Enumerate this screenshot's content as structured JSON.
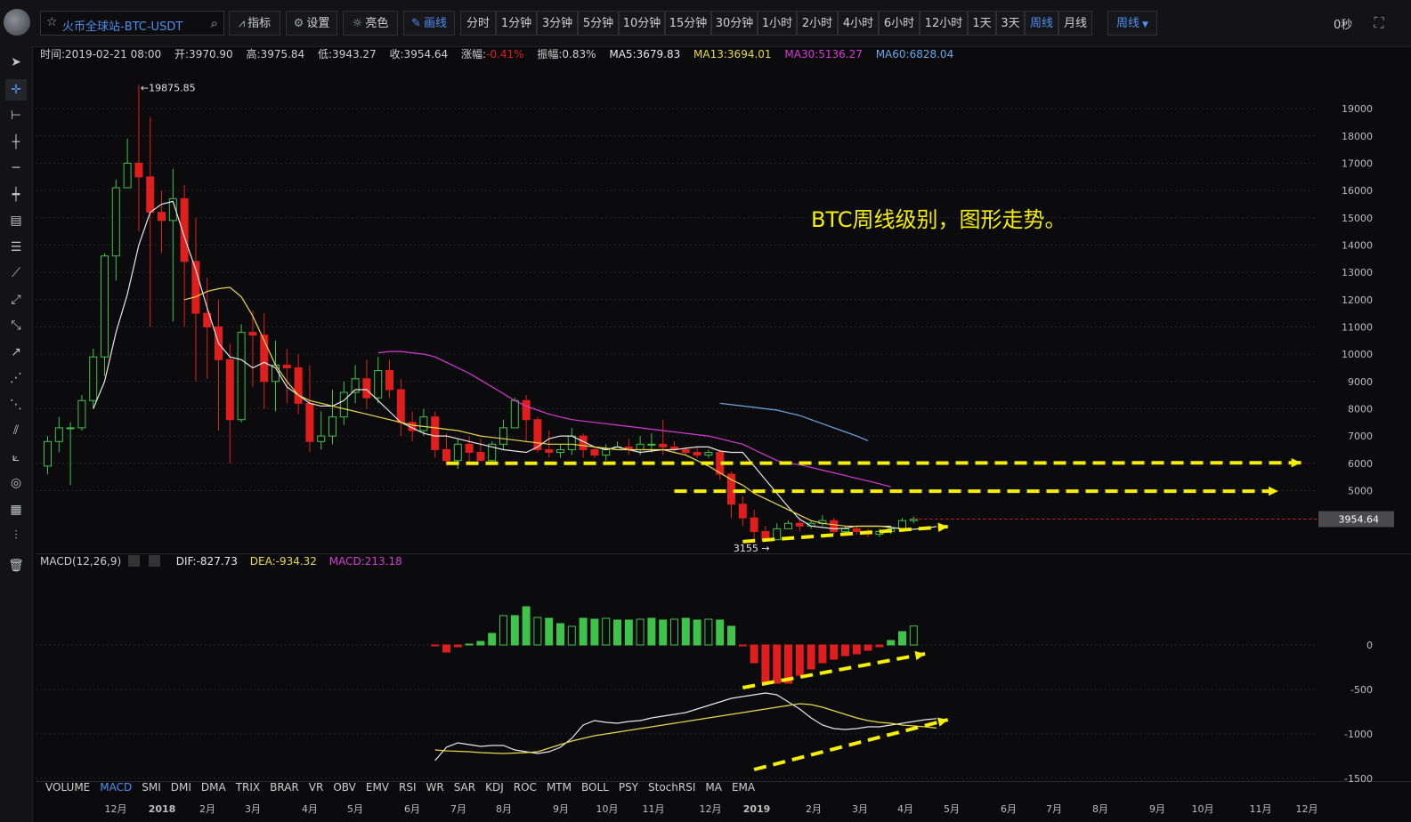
{
  "toolbar": {
    "symbol": "火币全球站-BTC-USDT",
    "indicator_btn": "指标",
    "settings_btn": "设置",
    "theme_btn": "亮色",
    "draw_btn": "画线",
    "periods": [
      "分时",
      "1分钟",
      "3分钟",
      "5分钟",
      "10分钟",
      "15分钟",
      "30分钟",
      "1小时",
      "2小时",
      "4小时",
      "6小时",
      "12小时",
      "1天",
      "3天",
      "周线",
      "月线"
    ],
    "active_period": "周线",
    "period_dropdown": "周线",
    "timer": "0秒"
  },
  "info": {
    "time": "时间:2019-02-21 08:00",
    "open": "开:3970.90",
    "high": "高:3975.84",
    "low": "低:3943.27",
    "close": "收:3954.64",
    "change_label": "涨幅:",
    "change_value": "-0.41%",
    "amplitude": "振幅:0.83%",
    "ma5": "MA5:3679.83",
    "ma13": "MA13:3694.01",
    "ma30": "MA30:5136.27",
    "ma60": "MA60:6828.04"
  },
  "macd_info": {
    "title": "MACD(12,26,9)",
    "dif": "DIF:-827.73",
    "dea": "DEA:-934.32",
    "macd": "MACD:213.18"
  },
  "annotation": "BTC周线级别，图形走势。",
  "indicators": [
    "VOLUME",
    "MACD",
    "SMI",
    "DMI",
    "DMA",
    "TRIX",
    "BRAR",
    "VR",
    "OBV",
    "EMV",
    "RSI",
    "WR",
    "SAR",
    "KDJ",
    "ROC",
    "MTM",
    "BOLL",
    "PSY",
    "StochRSI",
    "MA",
    "EMA"
  ],
  "active_indicator": "MACD",
  "colors": {
    "up": "#3fc34a",
    "down": "#e01e1e",
    "ma5": "#e8e8e8",
    "ma13": "#e8d84a",
    "ma30": "#d43bd4",
    "ma60": "#6aa8e8",
    "accent": "#4d8ff0",
    "annotation": "#f6f000"
  },
  "chart_data": {
    "type": "candlestick",
    "price_axis": {
      "ylim": [
        2700,
        20700
      ],
      "ticks": [
        5000,
        6000,
        7000,
        8000,
        9000,
        10000,
        11000,
        12000,
        13000,
        14000,
        15000,
        16000,
        17000,
        18000,
        19000
      ]
    },
    "macd_axis": {
      "ylim": [
        -1530,
        830
      ],
      "ticks": [
        0,
        -500,
        -1000,
        -1500
      ]
    },
    "x_labels": [
      "12月",
      "2018",
      "2月",
      "3月",
      "4月",
      "5月",
      "6月",
      "7月",
      "8月",
      "9月",
      "10月",
      "11月",
      "12月",
      "2019",
      "2月",
      "3月",
      "4月",
      "5月",
      "6月",
      "7月",
      "8月",
      "9月",
      "10月",
      "11月",
      "12月"
    ],
    "last_price": "3954.64",
    "high_label": "19875.85",
    "low_label": "3155",
    "candles": [
      [
        5900,
        6800,
        5600,
        7000
      ],
      [
        6800,
        7300,
        6400,
        7700
      ],
      [
        7300,
        7300,
        5200,
        7500
      ],
      [
        7300,
        8300,
        7200,
        8500
      ],
      [
        8300,
        9900,
        8000,
        10200
      ],
      [
        9900,
        13600,
        9200,
        13700
      ],
      [
        13600,
        16100,
        12700,
        16400
      ],
      [
        16100,
        17000,
        16200,
        17900
      ],
      [
        17000,
        16500,
        14500,
        19876
      ],
      [
        16500,
        15200,
        11000,
        18700
      ],
      [
        15200,
        14900,
        13700,
        16000
      ],
      [
        14900,
        15700,
        11200,
        16800
      ],
      [
        15700,
        13400,
        11000,
        16200
      ],
      [
        13400,
        11500,
        9000,
        15000
      ],
      [
        11500,
        11000,
        9100,
        12800
      ],
      [
        11000,
        9800,
        7200,
        12000
      ],
      [
        9800,
        7600,
        6000,
        10400
      ],
      [
        7600,
        10800,
        7500,
        11100
      ],
      [
        10800,
        10700,
        8800,
        11600
      ],
      [
        10700,
        9000,
        8000,
        11500
      ],
      [
        9000,
        9600,
        7900,
        10500
      ],
      [
        9600,
        9500,
        8200,
        10200
      ],
      [
        9500,
        8200,
        7800,
        10000
      ],
      [
        8200,
        6800,
        6400,
        9600
      ],
      [
        6800,
        7000,
        6500,
        7900
      ],
      [
        7000,
        7700,
        6700,
        8700
      ],
      [
        7700,
        8600,
        7400,
        9000
      ],
      [
        8600,
        9100,
        8200,
        9600
      ],
      [
        9100,
        8400,
        8000,
        9800
      ],
      [
        8400,
        9400,
        8200,
        9900
      ],
      [
        9400,
        8700,
        8400,
        9800
      ],
      [
        8700,
        7500,
        7000,
        9100
      ],
      [
        7500,
        7200,
        6800,
        7900
      ],
      [
        7200,
        7700,
        7000,
        8000
      ],
      [
        7700,
        6500,
        6200,
        7900
      ],
      [
        6500,
        6100,
        5900,
        7100
      ],
      [
        6100,
        6700,
        5800,
        6900
      ],
      [
        6700,
        6400,
        6000,
        7000
      ],
      [
        6400,
        6100,
        6100,
        6900
      ],
      [
        6100,
        6700,
        6000,
        6800
      ],
      [
        6700,
        7300,
        6500,
        7600
      ],
      [
        7300,
        8300,
        7300,
        8400
      ],
      [
        8300,
        7600,
        6800,
        8500
      ],
      [
        7600,
        6500,
        6400,
        7700
      ],
      [
        6500,
        6400,
        6200,
        7200
      ],
      [
        6400,
        6500,
        6200,
        6700
      ],
      [
        6500,
        7000,
        6300,
        7300
      ],
      [
        7000,
        6500,
        6200,
        7100
      ],
      [
        6500,
        6300,
        6200,
        6600
      ],
      [
        6300,
        6500,
        6100,
        6700
      ],
      [
        6500,
        6600,
        6500,
        6800
      ],
      [
        6600,
        6500,
        6300,
        6900
      ],
      [
        6500,
        6700,
        6300,
        7000
      ],
      [
        6700,
        6700,
        6400,
        7100
      ],
      [
        6700,
        6600,
        6300,
        7600
      ],
      [
        6600,
        6500,
        6400,
        6800
      ],
      [
        6500,
        6400,
        6300,
        6600
      ],
      [
        6400,
        6300,
        6200,
        6600
      ],
      [
        6300,
        6400,
        6200,
        6500
      ],
      [
        6400,
        5600,
        5400,
        6500
      ],
      [
        5600,
        4500,
        4000,
        5700
      ],
      [
        4500,
        4000,
        3700,
        4800
      ],
      [
        4000,
        3500,
        3200,
        4300
      ],
      [
        3500,
        3200,
        3155,
        3700
      ],
      [
        3200,
        3600,
        3200,
        3800
      ],
      [
        3600,
        3800,
        3600,
        3900
      ],
      [
        3800,
        3700,
        3500,
        4000
      ],
      [
        3700,
        3800,
        3600,
        3900
      ],
      [
        3800,
        3900,
        3700,
        4100
      ],
      [
        3900,
        3500,
        3400,
        4000
      ],
      [
        3500,
        3600,
        3400,
        3700
      ],
      [
        3600,
        3500,
        3400,
        3700
      ],
      [
        3500,
        3400,
        3300,
        3600
      ],
      [
        3400,
        3500,
        3300,
        3600
      ],
      [
        3500,
        3600,
        3400,
        3700
      ],
      [
        3600,
        3900,
        3600,
        4000
      ],
      [
        3900,
        3950,
        3800,
        4050
      ]
    ],
    "series": [
      {
        "id": "ma5",
        "name": "MA5",
        "start": 4,
        "values": [
          8000,
          9000,
          10800,
          12200,
          14000,
          15200,
          15500,
          15600,
          14300,
          13100,
          11700,
          10400,
          9900,
          9800,
          9500,
          9700,
          9500,
          8800,
          8500,
          8200,
          8100,
          8100,
          8300,
          8700,
          8700,
          8300,
          7900,
          7500,
          7300,
          7100,
          7000,
          7000,
          6900,
          6800,
          6700,
          6600,
          6500,
          6450,
          6400,
          6600,
          6900,
          7000,
          7000,
          6800,
          6600,
          6500,
          6600,
          6500,
          6400,
          6450,
          6500,
          6500,
          6550,
          6600,
          6600,
          6450,
          6400,
          6400,
          5900,
          5400,
          4900,
          4400,
          3950,
          3700,
          3650,
          3600,
          3620,
          3700,
          3700,
          3700,
          3650,
          3600,
          3580,
          3620,
          3680
        ]
      },
      {
        "id": "ma13",
        "name": "MA13",
        "start": 12,
        "values": [
          12000,
          12100,
          12300,
          12400,
          12450,
          12100,
          11400,
          10500,
          9600,
          9000,
          8500,
          8300,
          8200,
          8100,
          8000,
          7900,
          7800,
          7700,
          7600,
          7500,
          7400,
          7350,
          7300,
          7250,
          7200,
          7100,
          7000,
          6950,
          6900,
          6850,
          6800,
          6750,
          6700,
          6700,
          6700,
          6650,
          6600,
          6550,
          6500,
          6500,
          6500,
          6500,
          6500,
          6400,
          6300,
          6100,
          5900,
          5650,
          5400,
          5200,
          4900,
          4700,
          4500,
          4300,
          4100,
          3900,
          3800,
          3750,
          3700,
          3690,
          3690,
          3690,
          3694
        ]
      },
      {
        "id": "ma30",
        "name": "MA30",
        "start": 29,
        "values": [
          10050,
          10100,
          10100,
          10050,
          10000,
          9900,
          9700,
          9500,
          9300,
          9050,
          8800,
          8550,
          8300,
          8100,
          7950,
          7800,
          7700,
          7600,
          7550,
          7500,
          7450,
          7400,
          7350,
          7300,
          7250,
          7200,
          7150,
          7100,
          7050,
          7000,
          6900,
          6800,
          6700,
          6500,
          6300,
          6100,
          6000,
          5950,
          5850,
          5750,
          5650,
          5550,
          5450,
          5350,
          5250,
          5136
        ]
      },
      {
        "id": "ma60",
        "name": "MA60",
        "start": 59,
        "values": [
          8200,
          8150,
          8100,
          8050,
          8000,
          7950,
          7850,
          7750,
          7600,
          7450,
          7300,
          7150,
          7000,
          6828
        ]
      }
    ],
    "macd": {
      "start": 34,
      "hist": [
        -10,
        -80,
        -20,
        10,
        40,
        130,
        330,
        330,
        430,
        310,
        300,
        240,
        210,
        300,
        290,
        300,
        280,
        280,
        290,
        300,
        280,
        290,
        300,
        280,
        290,
        280,
        210,
        -10,
        -200,
        -420,
        -430,
        -430,
        -340,
        -270,
        -200,
        -160,
        -120,
        -100,
        -60,
        -20,
        50,
        150,
        213
      ],
      "dif": [
        -1300,
        -1150,
        -1100,
        -1120,
        -1140,
        -1130,
        -1130,
        -1180,
        -1200,
        -1220,
        -1200,
        -1150,
        -1050,
        -900,
        -850,
        -870,
        -880,
        -860,
        -850,
        -820,
        -800,
        -780,
        -760,
        -720,
        -680,
        -640,
        -600,
        -580,
        -560,
        -540,
        -560,
        -640,
        -720,
        -820,
        -900,
        -940,
        -950,
        -940,
        -920,
        -920,
        -900,
        -880,
        -860,
        -840,
        -828
      ],
      "dea": [
        -1180,
        -1190,
        -1195,
        -1200,
        -1210,
        -1215,
        -1220,
        -1215,
        -1210,
        -1200,
        -1160,
        -1120,
        -1080,
        -1050,
        -1020,
        -1000,
        -980,
        -960,
        -940,
        -920,
        -900,
        -880,
        -860,
        -840,
        -820,
        -800,
        -780,
        -760,
        -740,
        -720,
        -700,
        -680,
        -660,
        -670,
        -700,
        -740,
        -780,
        -820,
        -850,
        -870,
        -880,
        -900,
        -910,
        -920,
        -934
      ]
    },
    "trendlines": [
      {
        "from": [
          35,
          6000
        ],
        "to": [
          110,
          6020
        ]
      },
      {
        "from": [
          55,
          4980
        ],
        "to": [
          108,
          4980
        ]
      },
      {
        "from": [
          61,
          3130
        ],
        "to": [
          79,
          3680
        ]
      },
      {
        "macd": true,
        "from": [
          61,
          -480
        ],
        "to": [
          77,
          -100
        ]
      },
      {
        "macd": true,
        "from": [
          62,
          -1400
        ],
        "to": [
          79,
          -840
        ]
      }
    ]
  }
}
